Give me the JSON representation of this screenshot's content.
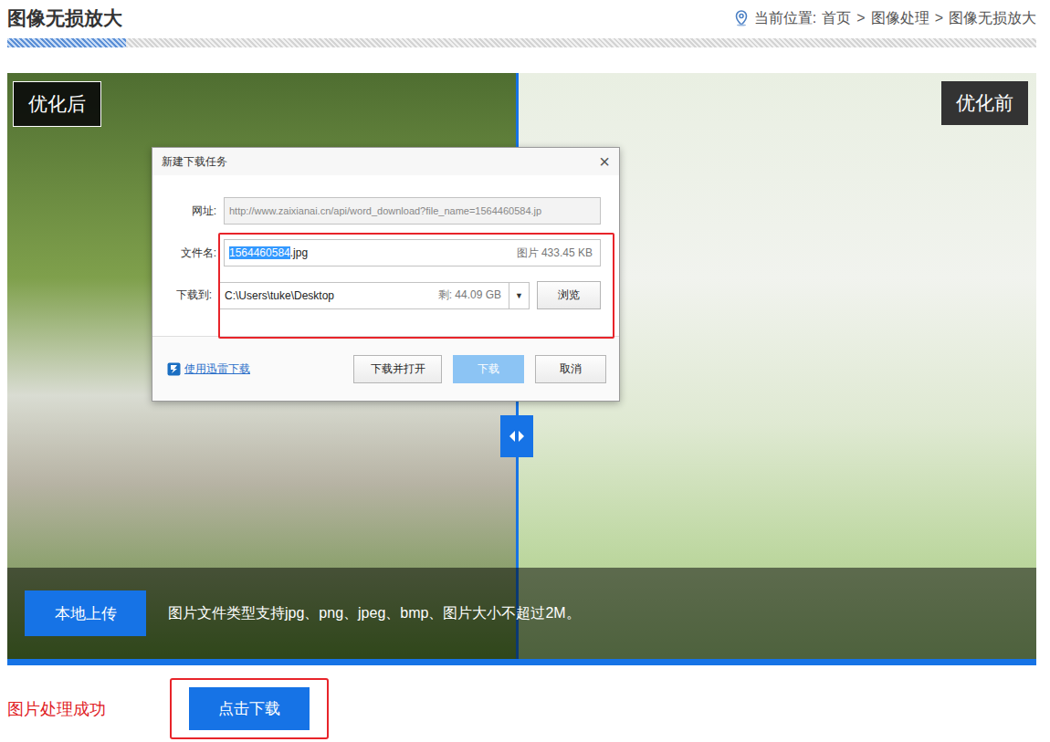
{
  "header": {
    "title": "图像无损放大",
    "breadcrumb": {
      "prefix": "当前位置:",
      "items": [
        "首页",
        "图像处理",
        "图像无损放大"
      ],
      "separator": ">"
    }
  },
  "compare": {
    "level": 0.494,
    "after_label": "优化后",
    "before_label": "优化前"
  },
  "upload": {
    "button": "本地上传",
    "hint": "图片文件类型支持jpg、png、jpeg、bmp、图片大小不超过2M。"
  },
  "dialog": {
    "title": "新建下载任务",
    "close": "×",
    "url": {
      "label": "网址:",
      "value": "http://www.zaixianai.cn/api/word_download?file_name=1564460584.jp",
      "disabled": true
    },
    "file_name": {
      "label": "文件名:",
      "selected_part": "1564460584",
      "rest": ".jpg",
      "info": "图片 433.45 KB"
    },
    "save_to": {
      "label": "下载到:",
      "path": "C:\\Users\\tuke\\Desktop",
      "free": "剩: 44.09 GB",
      "dropdown": "▼",
      "browse": "浏览"
    },
    "thunder_link": "使用迅雷下载",
    "buttons": [
      {
        "label": "下载并打开",
        "primary": false
      },
      {
        "label": "下载",
        "primary": true
      },
      {
        "label": "取消",
        "primary": false
      }
    ]
  },
  "status": {
    "message": "图片处理成功",
    "download_button": "点击下载"
  }
}
